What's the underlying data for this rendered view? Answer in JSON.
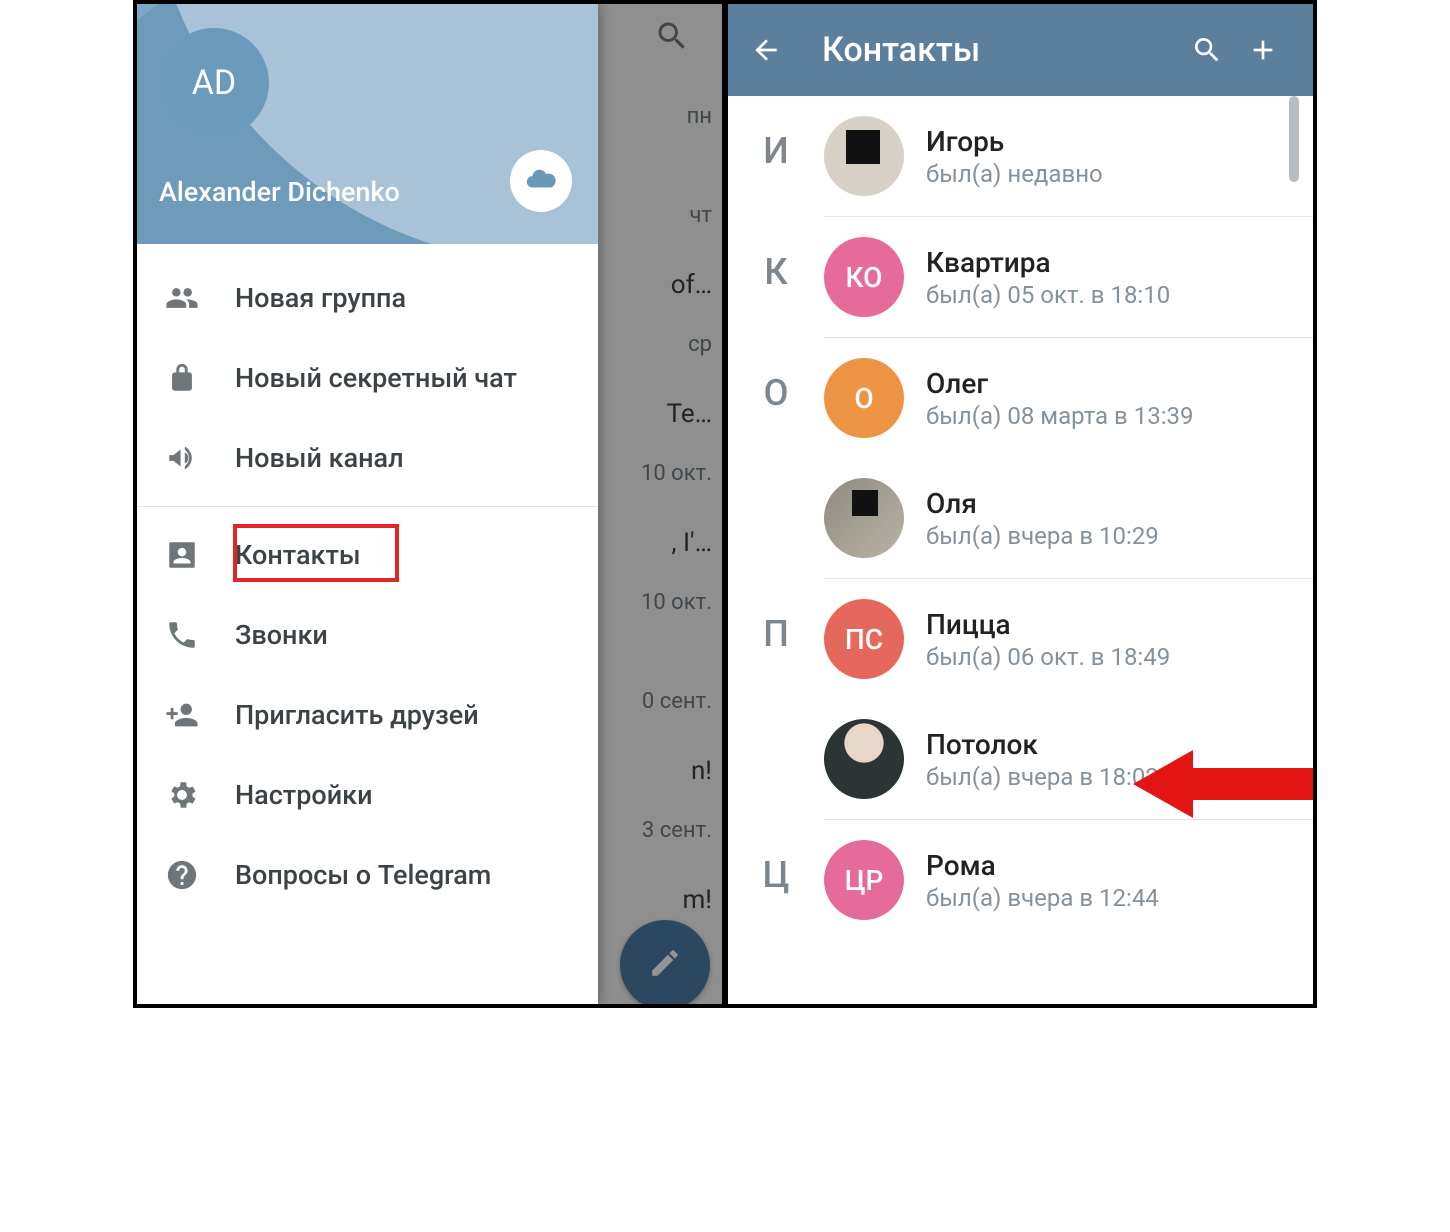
{
  "left_panel": {
    "avatar_initials": "AD",
    "user_name": "Alexander Dichenko",
    "menu": {
      "new_group": "Новая группа",
      "secret_chat": "Новый секретный чат",
      "new_channel": "Новый канал",
      "contacts": "Контакты",
      "calls": "Звонки",
      "invite": "Пригласить друзей",
      "settings": "Настройки",
      "faq": "Вопросы о Telegram"
    },
    "chat_preview": {
      "r1_day": "пн",
      "r2_day": "чт",
      "r2_snip": "of…",
      "r3_day": "ср",
      "r3_snip": "Te…",
      "r4_day": "10 окт.",
      "r4_snip": ", I'…",
      "r5_day": "10 окт.",
      "r6_day": "0 сент.",
      "r6_snip": "n!",
      "r7_day": "3 сент.",
      "r7_snip": "m!"
    }
  },
  "right_panel": {
    "title": "Контакты",
    "sections": [
      {
        "letter": "И",
        "items": [
          {
            "name": "Игорь",
            "status": "был(а) недавно",
            "avatar_type": "photo1"
          }
        ]
      },
      {
        "letter": "К",
        "items": [
          {
            "name": "Квартира",
            "status": "был(а) 05 окт. в 18:10",
            "avatar_type": "initials",
            "initials": "КО",
            "color": "#e66b9b"
          }
        ]
      },
      {
        "letter": "О",
        "items": [
          {
            "name": "Олег",
            "status": "был(а) 08 марта в 13:39",
            "avatar_type": "initials",
            "initials": "О",
            "color": "#ed9444"
          },
          {
            "name": "Оля",
            "status": "был(а) вчера в 10:29",
            "avatar_type": "photo2"
          }
        ]
      },
      {
        "letter": "П",
        "items": [
          {
            "name": "Пицца",
            "status": "был(а) 06 окт. в 18:49",
            "avatar_type": "initials",
            "initials": "ПС",
            "color": "#e4685b"
          },
          {
            "name": "Потолок",
            "status": "был(а) вчера в 18:02",
            "avatar_type": "photo3"
          }
        ]
      },
      {
        "letter": "Ц",
        "items": [
          {
            "name": "Рома",
            "status": "был(а) вчера в 12:44",
            "avatar_type": "initials",
            "initials": "ЦР",
            "color": "#e66b9b"
          }
        ]
      }
    ]
  }
}
